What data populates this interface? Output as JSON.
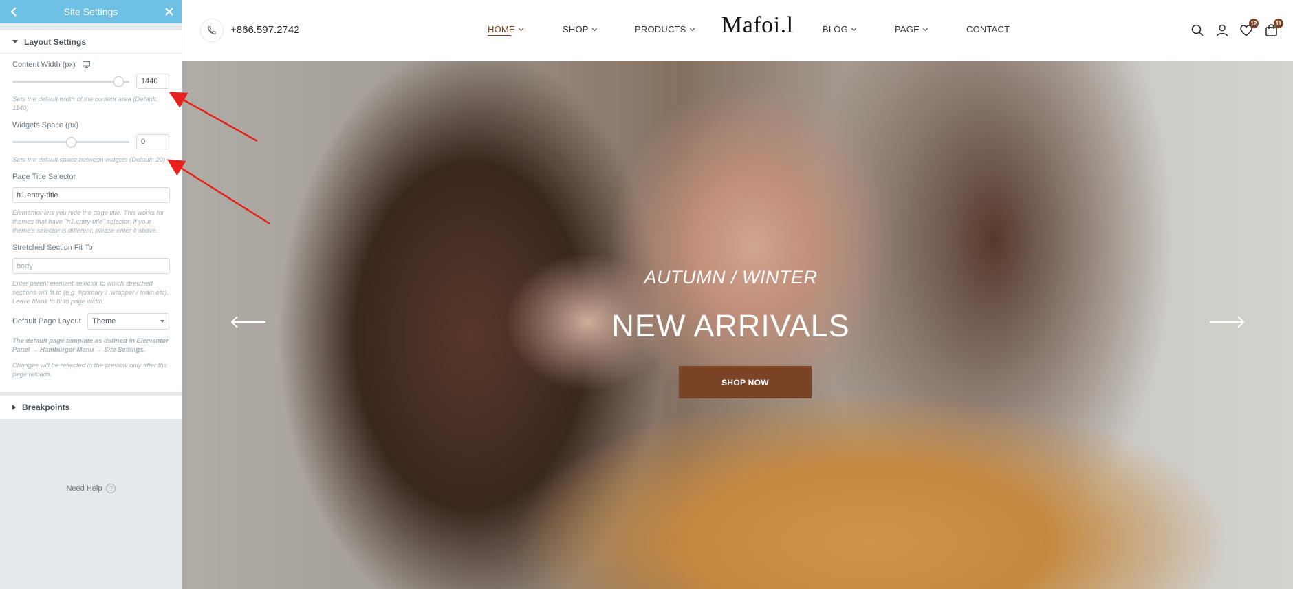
{
  "panel": {
    "title": "Site Settings",
    "layout_section": {
      "title": "Layout Settings",
      "content_width": {
        "label": "Content Width (px)",
        "value": "1440",
        "slider_fraction": 0.95,
        "description": "Sets the default width of the content area (Default: 1140)"
      },
      "widgets_space": {
        "label": "Widgets Space (px)",
        "value": "0",
        "slider_fraction": 0.5,
        "description": "Sets the default space between widgets (Default: 20)"
      },
      "page_title_selector": {
        "label": "Page Title Selector",
        "value": "h1.entry-title",
        "description": "Elementor lets you hide the page title. This works for themes that have \"h1.entry-title\" selector. If your theme's selector is different, please enter it above."
      },
      "stretched_section": {
        "label": "Stretched Section Fit To",
        "placeholder": "body",
        "description": "Enter parent element selector to which stretched sections will fit to (e.g. #primary / .wrapper / main etc). Leave blank to fit to page width."
      },
      "default_page_layout": {
        "label": "Default Page Layout",
        "value": "Theme",
        "description_bold": "The default page template as defined in Elementor Panel → Hamburger Menu → Site Settings.",
        "description_note": "Changes will be reflected in the preview only after the page reloads."
      }
    },
    "breakpoints_section": {
      "title": "Breakpoints"
    },
    "need_help": "Need Help",
    "help_glyph": "?"
  },
  "site": {
    "phone": "+866.597.2742",
    "logo": "Mafoi.l",
    "nav": {
      "home": "HOME",
      "shop": "SHOP",
      "products": "PRODUCTS",
      "blog": "BLOG",
      "page": "PAGE",
      "contact": "CONTACT"
    },
    "wishlist_count": "12",
    "cart_count": "11",
    "hero": {
      "subtitle": "AUTUMN / WINTER",
      "title": "NEW ARRIVALS",
      "button": "SHOP NOW"
    }
  },
  "colors": {
    "panel_header": "#6ec1e4",
    "brand_accent": "#7a4326",
    "annotation_arrow": "#e8211c"
  }
}
